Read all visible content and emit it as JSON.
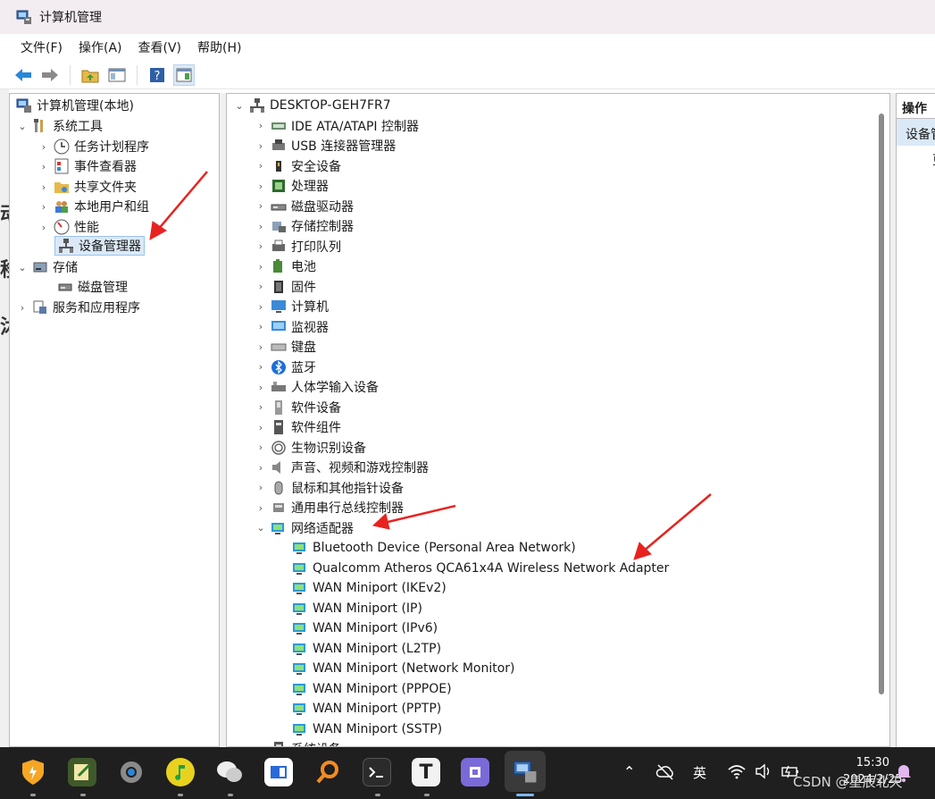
{
  "window": {
    "title": "计算机管理"
  },
  "menu": [
    "文件(F)",
    "操作(A)",
    "查看(V)",
    "帮助(H)"
  ],
  "left_tree": {
    "root": "计算机管理(本地)",
    "system_tools": "系统工具",
    "children": [
      "任务计划程序",
      "事件查看器",
      "共享文件夹",
      "本地用户和组",
      "性能",
      "设备管理器"
    ],
    "storage": "存储",
    "disk_management": "磁盘管理",
    "services": "服务和应用程序"
  },
  "device_tree": {
    "root": "DESKTOP-GEH7FR7",
    "categories": [
      "IDE ATA/ATAPI 控制器",
      "USB 连接器管理器",
      "安全设备",
      "处理器",
      "磁盘驱动器",
      "存储控制器",
      "打印队列",
      "电池",
      "固件",
      "计算机",
      "监视器",
      "键盘",
      "蓝牙",
      "人体学输入设备",
      "软件设备",
      "软件组件",
      "生物识别设备",
      "声音、视频和游戏控制器",
      "鼠标和其他指针设备",
      "通用串行总线控制器"
    ],
    "network": "网络适配器",
    "adapters": [
      "Bluetooth Device (Personal Area Network)",
      "Qualcomm Atheros QCA61x4A Wireless Network Adapter",
      "WAN Miniport (IKEv2)",
      "WAN Miniport (IP)",
      "WAN Miniport (IPv6)",
      "WAN Miniport (L2TP)",
      "WAN Miniport (Network Monitor)",
      "WAN Miniport (PPPOE)",
      "WAN Miniport (PPTP)",
      "WAN Miniport (SSTP)"
    ],
    "next": "系统设备"
  },
  "actions_pane": {
    "header": "操作",
    "item": "设备管",
    "sub": "更"
  },
  "taskbar": {
    "ime": "英",
    "time": "15:30",
    "date": "2024/2/25"
  },
  "watermark": "CSDN @星辰北天",
  "colors": {
    "arrow": "#e8231f",
    "selection": "#dbe9f7",
    "titlebar": "#f3ecf1",
    "taskbar": "#1f1f1f"
  }
}
